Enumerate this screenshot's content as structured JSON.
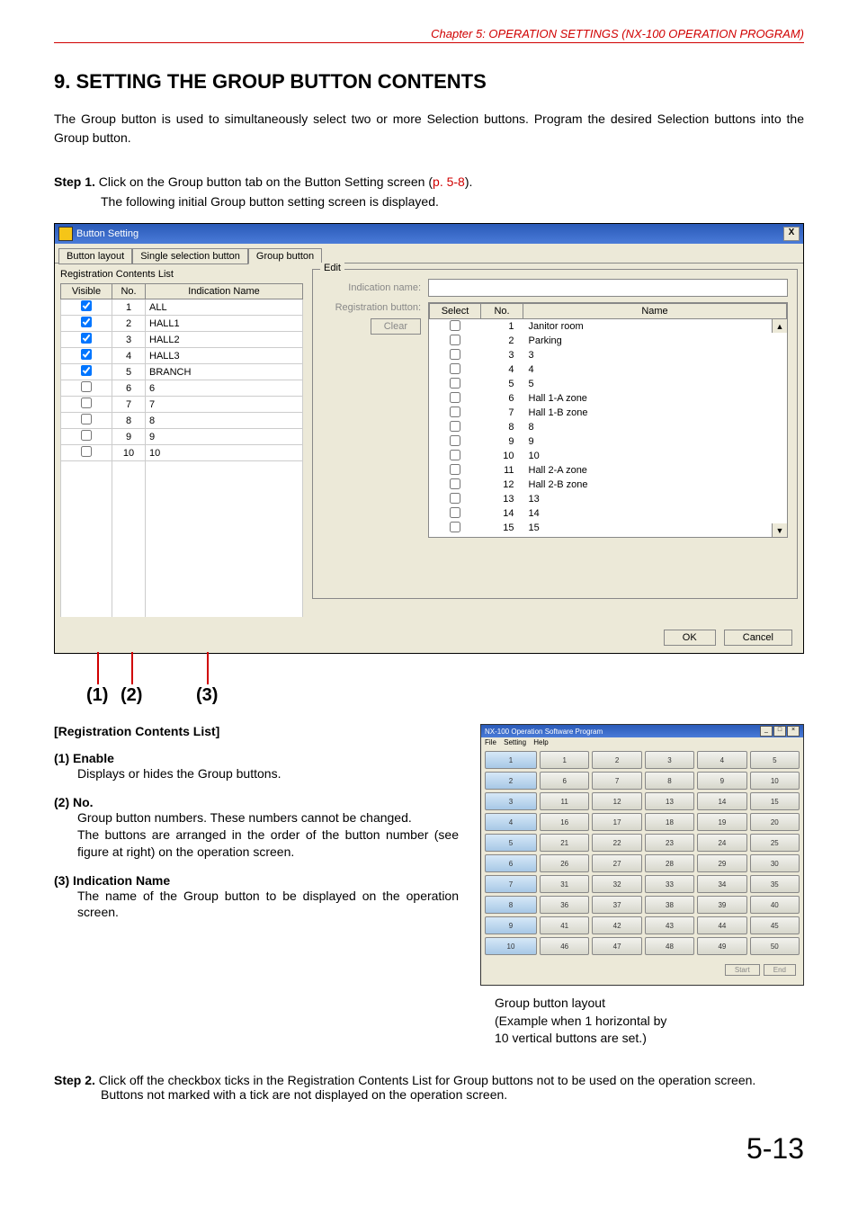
{
  "chapter": "Chapter 5:  OPERATION SETTINGS (NX-100 OPERATION PROGRAM)",
  "title": "9. SETTING THE GROUP BUTTON CONTENTS",
  "intro": "The Group button is used to simultaneously select two or more Selection buttons. Program the desired Selection buttons into the Group button.",
  "step1": {
    "label": "Step 1.",
    "line1_a": "Click on the Group button tab on the Button Setting screen (",
    "link": "p. 5-8",
    "line1_b": ").",
    "line2": "The following initial Group button setting screen is displayed."
  },
  "win": {
    "title": "Button Setting",
    "close": "X",
    "tabs": [
      "Button layout",
      "Single selection button",
      "Group button"
    ],
    "activeTab": 2,
    "listTitle": "Registration Contents List",
    "headers": {
      "visible": "Visible",
      "no": "No.",
      "name": "Indication Name"
    },
    "rows": [
      {
        "checked": true,
        "no": "1",
        "name": "ALL"
      },
      {
        "checked": true,
        "no": "2",
        "name": "HALL1"
      },
      {
        "checked": true,
        "no": "3",
        "name": "HALL2"
      },
      {
        "checked": true,
        "no": "4",
        "name": "HALL3"
      },
      {
        "checked": true,
        "no": "5",
        "name": "BRANCH"
      },
      {
        "checked": false,
        "no": "6",
        "name": "6"
      },
      {
        "checked": false,
        "no": "7",
        "name": "7"
      },
      {
        "checked": false,
        "no": "8",
        "name": "8"
      },
      {
        "checked": false,
        "no": "9",
        "name": "9"
      },
      {
        "checked": false,
        "no": "10",
        "name": "10"
      }
    ],
    "edit": {
      "legend": "Edit",
      "indLabel": "Indication name:",
      "regLabel": "Registration button:",
      "clear": "Clear",
      "selHeaders": {
        "select": "Select",
        "no": "No.",
        "name": "Name"
      },
      "selRows": [
        {
          "no": "1",
          "name": "Janitor room"
        },
        {
          "no": "2",
          "name": "Parking"
        },
        {
          "no": "3",
          "name": "3"
        },
        {
          "no": "4",
          "name": "4"
        },
        {
          "no": "5",
          "name": "5"
        },
        {
          "no": "6",
          "name": "Hall 1-A zone"
        },
        {
          "no": "7",
          "name": "Hall 1-B zone"
        },
        {
          "no": "8",
          "name": "8"
        },
        {
          "no": "9",
          "name": "9"
        },
        {
          "no": "10",
          "name": "10"
        },
        {
          "no": "11",
          "name": "Hall 2-A zone"
        },
        {
          "no": "12",
          "name": "Hall 2-B zone"
        },
        {
          "no": "13",
          "name": "13"
        },
        {
          "no": "14",
          "name": "14"
        },
        {
          "no": "15",
          "name": "15"
        }
      ]
    },
    "ok": "OK",
    "cancel": "Cancel"
  },
  "callouts": {
    "c1": "(1)",
    "c2": "(2)",
    "c3": "(3)"
  },
  "regTitle": "[Registration Contents List]",
  "def1": {
    "label": "(1) Enable",
    "body": "Displays or hides the Group buttons."
  },
  "def2": {
    "label": "(2) No.",
    "body1": "Group button numbers. These numbers cannot be changed.",
    "body2": "The buttons are arranged in the order of the button number (see figure at right) on the operation screen."
  },
  "def3": {
    "label": "(3) Indication Name",
    "body": "The name of the Group button to be displayed on the operation screen."
  },
  "opwin": {
    "title": "NX-100 Operation Software Program",
    "menu": [
      "File",
      "Setting",
      "Help"
    ],
    "groupCol": [
      "1",
      "2",
      "3",
      "4",
      "5",
      "6",
      "7",
      "8",
      "9",
      "10"
    ],
    "grid": [
      [
        "1",
        "2",
        "3",
        "4",
        "5"
      ],
      [
        "6",
        "7",
        "8",
        "9",
        "10"
      ],
      [
        "11",
        "12",
        "13",
        "14",
        "15"
      ],
      [
        "16",
        "17",
        "18",
        "19",
        "20"
      ],
      [
        "21",
        "22",
        "23",
        "24",
        "25"
      ],
      [
        "26",
        "27",
        "28",
        "29",
        "30"
      ],
      [
        "31",
        "32",
        "33",
        "34",
        "35"
      ],
      [
        "36",
        "37",
        "38",
        "39",
        "40"
      ],
      [
        "41",
        "42",
        "43",
        "44",
        "45"
      ],
      [
        "46",
        "47",
        "48",
        "49",
        "50"
      ]
    ],
    "start": "Start",
    "end": "End"
  },
  "caption1": "Group button layout",
  "caption2": "(Example when 1 horizontal by",
  "caption3": "10 vertical buttons are set.)",
  "step2": {
    "label": "Step 2.",
    "line1": "Click off the checkbox ticks in the Registration Contents List for Group buttons not to be used on the operation screen.",
    "line2": "Buttons not marked with a tick are not displayed on the operation screen."
  },
  "pageNo": "5-13"
}
